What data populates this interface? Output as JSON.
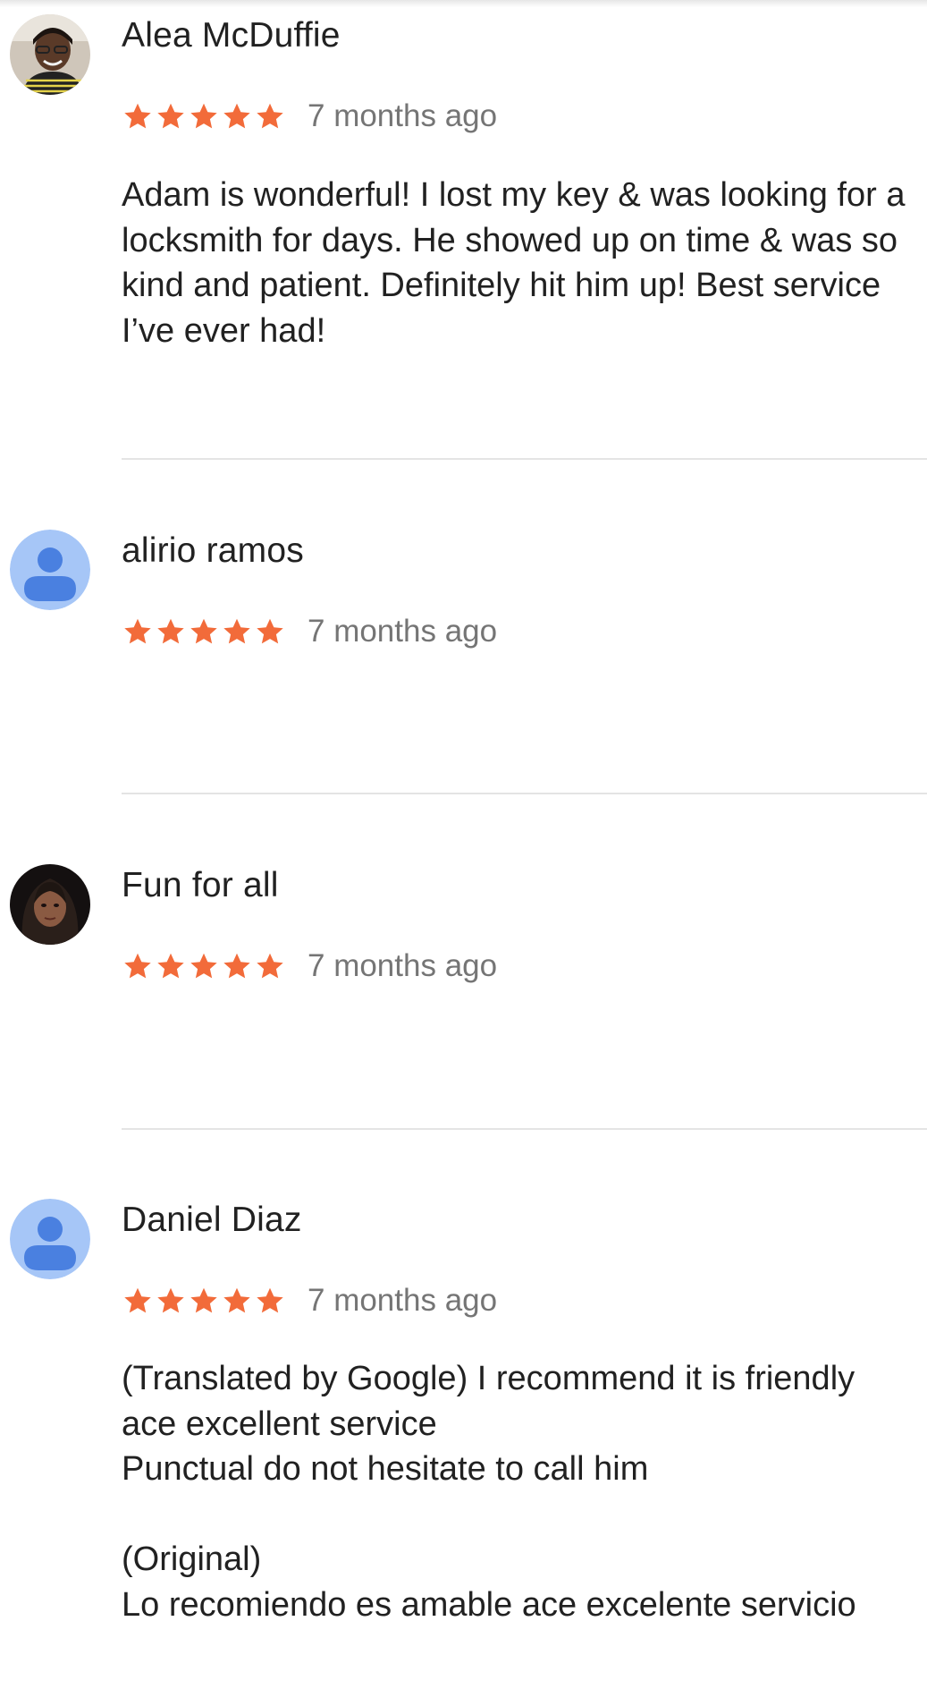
{
  "colors": {
    "star": "#f26b3a",
    "time": "#757575",
    "name": "#212121",
    "divider": "#e4e4e4",
    "default_avatar_bg": "#a6c6f7",
    "default_avatar_fg": "#4a80e0"
  },
  "reviews": [
    {
      "author": "Alea McDuffie",
      "avatar": "photo-avatar",
      "rating": 5,
      "time": "7 months ago",
      "text": "Adam is wonderful! I lost my key & was looking for a locksmith for days. He showed up on time & was so kind and patient. Definitely hit him up! Best service I’ve ever had!"
    },
    {
      "author": "alirio ramos",
      "avatar": "default-person-avatar",
      "rating": 5,
      "time": "7 months ago",
      "text": ""
    },
    {
      "author": "Fun for all",
      "avatar": "photo-avatar",
      "rating": 5,
      "time": "7 months ago",
      "text": ""
    },
    {
      "author": "Daniel Diaz",
      "avatar": "default-person-avatar",
      "rating": 5,
      "time": "7 months ago",
      "text": "(Translated by Google) I recommend it is friendly ace excellent service\nPunctual do not hesitate to call him\n\n(Original)\nLo recomiendo es amable ace excelente servicio"
    }
  ]
}
